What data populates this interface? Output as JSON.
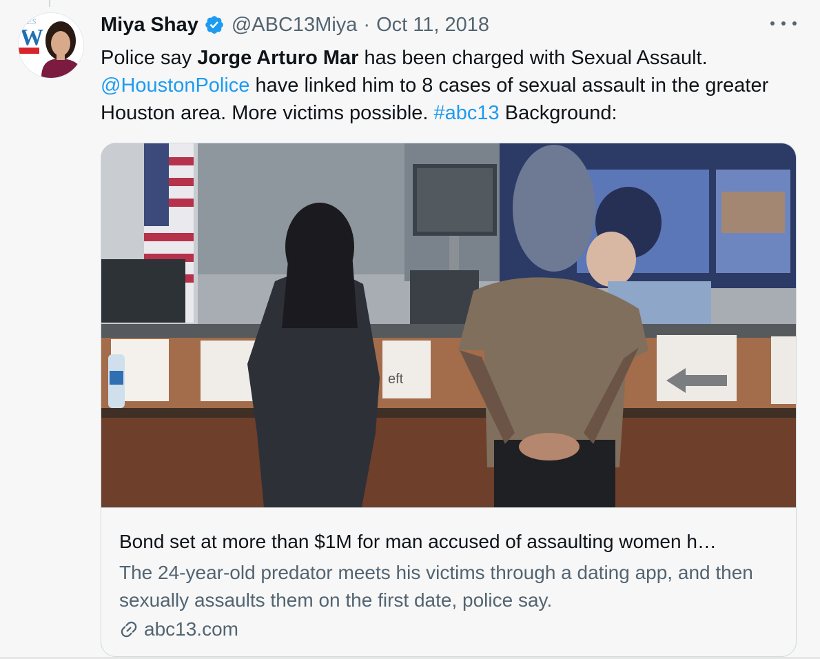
{
  "tweet": {
    "author_name": "Miya Shay",
    "handle": "@ABC13Miya",
    "separator": "·",
    "date": "Oct 11, 2018",
    "text_parts": [
      {
        "text": "Police say ",
        "style": "normal"
      },
      {
        "text": "Jorge Arturo Mar",
        "style": "bold"
      },
      {
        "text": " has been charged with Sexual Assault. ",
        "style": "normal"
      },
      {
        "text": "@HoustonPolice",
        "style": "link"
      },
      {
        "text": " have linked him to 8 cases of sexual assault in the greater Houston area. More victims possible. ",
        "style": "normal"
      },
      {
        "text": "#abc13",
        "style": "link"
      },
      {
        "text": " Background:",
        "style": "normal"
      }
    ],
    "icons": {
      "verified": "verified-badge-icon",
      "more": "more-options-icon",
      "link": "link-icon"
    }
  },
  "avatar": {
    "logo_text_top": "NES",
    "logo_letter": "W"
  },
  "card": {
    "title": "Bond set at more than $1M for man accused of assaulting women h…",
    "description": "The 24-year-old predator meets his victims through a dating app, and then sexually assaults them on the first date, police say.",
    "domain": "abc13.com",
    "image_sign_text": "eft"
  },
  "colors": {
    "link": "#1d9bf0",
    "secondary_text": "#536471",
    "background": "#f7f7f7",
    "border": "#cfd9de"
  }
}
